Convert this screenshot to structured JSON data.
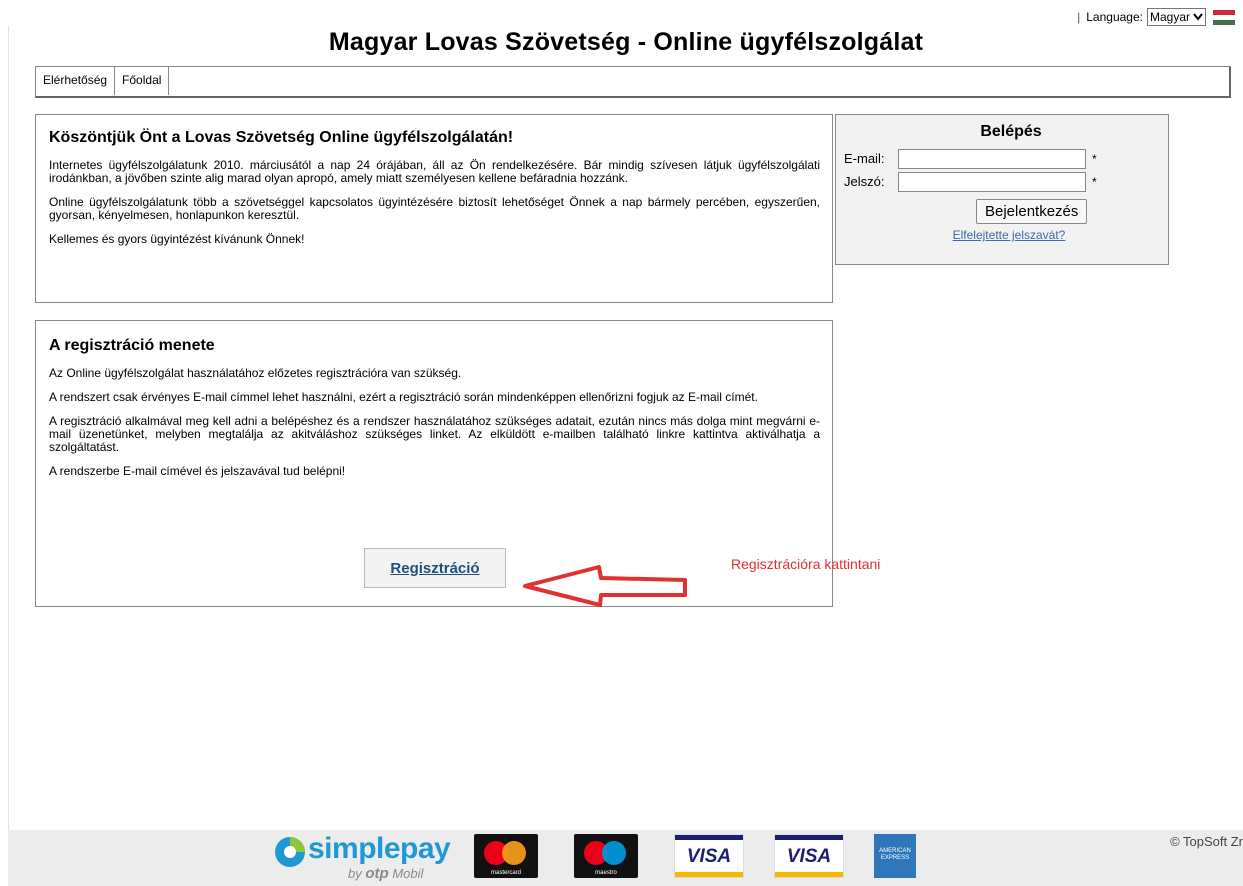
{
  "language_bar": {
    "separator": "|",
    "label": "Language:",
    "selected": "Magyar"
  },
  "site": {
    "title": "Magyar Lovas Szövetség - Online ügyfélszolgálat"
  },
  "nav": {
    "items": [
      {
        "label": "Elérhetőség"
      },
      {
        "label": "Főoldal"
      }
    ]
  },
  "welcome": {
    "heading": "Köszöntjük Önt a Lovas Szövetség Online ügyfélszolgálatán!",
    "paragraphs": [
      "Internetes ügyfélszolgálatunk 2010. márciusától a nap 24 órájában, áll az Ön rendelkezésére. Bár mindig szívesen látjuk ügyfélszolgálati irodánkban, a jövőben szinte alig marad olyan apropó, amely miatt személyesen kellene befáradnia hozzánk.",
      "Online ügyfélszolgálatunk több a szövetséggel kapcsolatos ügyintézésére biztosít lehetőséget Önnek a nap bármely percében, egyszerűen, gyorsan, kényelmesen, honlapunkon keresztül.",
      "Kellemes és gyors ügyintézést kívánunk Önnek!"
    ]
  },
  "registration": {
    "heading": "A regisztráció menete",
    "paragraphs": [
      "Az Online ügyfélszolgálat használatához előzetes regisztrációra van szükség.",
      "A rendszert csak érvényes E-mail címmel lehet használni, ezért a regisztráció során mindenképpen ellenőrizni fogjuk az E-mail címét.",
      "A regisztráció alkalmával meg kell adni a belépéshez és a rendszer használatához szükséges adatait, ezután nincs más dolga mint megvárni e-mail üzenetünket, melyben megtalálja az akitváláshoz szükséges linket. Az elküldött e-mailben található linkre kattintva aktiválhatja a szolgáltatást.",
      "A rendszerbe E-mail címével és jelszavával tud belépni!"
    ],
    "button_label": "Regisztráció"
  },
  "login": {
    "title": "Belépés",
    "email_label": "E-mail:",
    "email_value": "",
    "password_label": "Jelszó:",
    "password_value": "",
    "required_mark": "*",
    "submit_label": "Bejelentkezés",
    "forgot_link": "Elfelejtette jelszavát?"
  },
  "annotation": {
    "text": "Regisztrációra kattintani",
    "color": "#e03030"
  },
  "footer": {
    "copyright": "© TopSoft Zr",
    "simplepay": {
      "brand_a": "simple",
      "brand_b": "pay",
      "by": "by",
      "otp": "otp",
      "mobil": "Mobil"
    },
    "cards": {
      "mastercard": "mastercard",
      "maestro": "maestro",
      "visa": "VISA",
      "visa_electron": "VISA",
      "amex": "AMERICAN EXPRESS"
    }
  },
  "colors": {
    "link": "#3d6aa8",
    "register_link": "#1f4f7d",
    "login_bg": "#f2f2f2",
    "footer_bg": "#ececec"
  }
}
